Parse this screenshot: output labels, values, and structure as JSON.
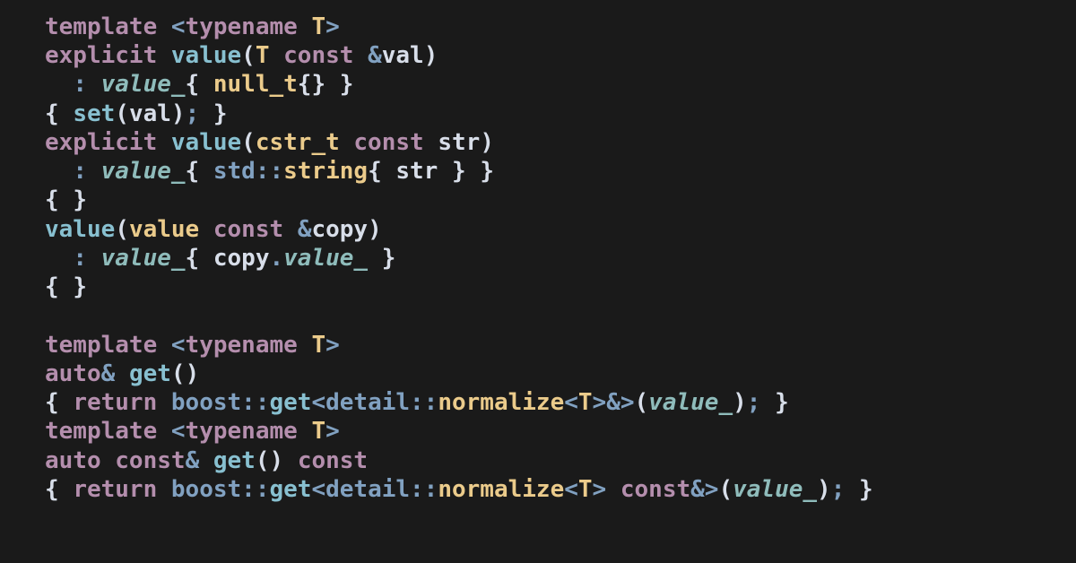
{
  "kw_template": "template",
  "kw_typename": "typename",
  "kw_explicit": "explicit",
  "kw_const": "const",
  "kw_return": "return",
  "kw_auto": "auto",
  "lt": "<",
  "gt": ">",
  "amp": "&",
  "dcolon": "::",
  "lbrace": "{",
  "rbrace": "}",
  "lparen": "(",
  "rparen": ")",
  "colon": ":",
  "dot": ".",
  "semi": ";",
  "ty_T": "T",
  "ty_cstr_t": "cstr_t",
  "ty_value": "value",
  "ty_null_t": "null_t",
  "ty_string": "string",
  "ty_normalize": "normalize",
  "ns_detail": "detail",
  "ns_std": "std",
  "ns_boost": "boost",
  "fn_ctor": "value",
  "fn_set": "set",
  "fn_get": "get",
  "mem_value": "value_",
  "prm_val": "val",
  "prm_str": "str",
  "prm_copy": "copy"
}
